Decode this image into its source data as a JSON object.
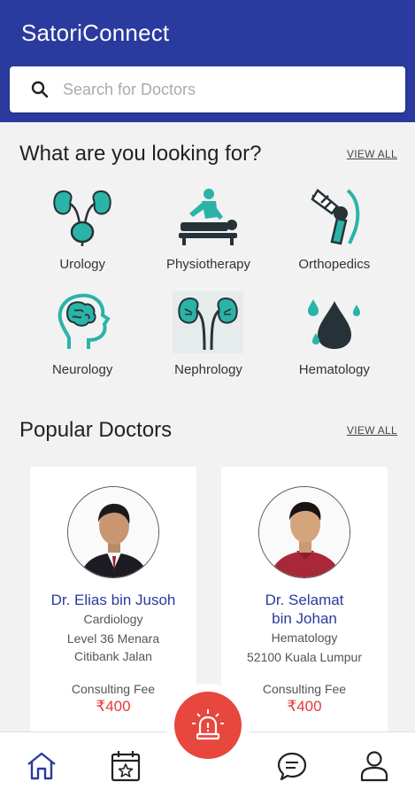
{
  "app": {
    "title": "SatoriConnect"
  },
  "search": {
    "placeholder": "Search for Doctors"
  },
  "categories_section": {
    "title": "What are you looking for?",
    "view_all": "VIEW ALL",
    "items": [
      {
        "label": "Urology",
        "icon": "kidney-bladder-icon"
      },
      {
        "label": "Physiotherapy",
        "icon": "massage-therapy-icon"
      },
      {
        "label": "Orthopedics",
        "icon": "knee-joint-icon"
      },
      {
        "label": "Neurology",
        "icon": "brain-head-icon"
      },
      {
        "label": "Nephrology",
        "icon": "kidneys-icon"
      },
      {
        "label": "Hematology",
        "icon": "blood-drop-icon"
      }
    ]
  },
  "doctors_section": {
    "title": "Popular Doctors",
    "view_all": "VIEW ALL",
    "doctors": [
      {
        "name": "Dr. Elias bin Jusoh",
        "specialty": "Cardiology",
        "address": "Level 36 Menara Citibank Jalan",
        "fee_label": "Consulting Fee",
        "fee": "₹400"
      },
      {
        "name": "Dr. Selamat bin Johan",
        "specialty": "Hematology",
        "address": "52100 Kuala Lumpur",
        "fee_label": "Consulting Fee",
        "fee": "₹400"
      }
    ]
  },
  "colors": {
    "primary": "#2b3a9e",
    "teal": "#2bb3a8",
    "dark": "#263238",
    "fee": "#e53935",
    "emergency": "#e8473d"
  },
  "bottom_nav": [
    "home-icon",
    "calendar-star-icon",
    "emergency-siren-icon",
    "chat-icon",
    "profile-icon"
  ]
}
